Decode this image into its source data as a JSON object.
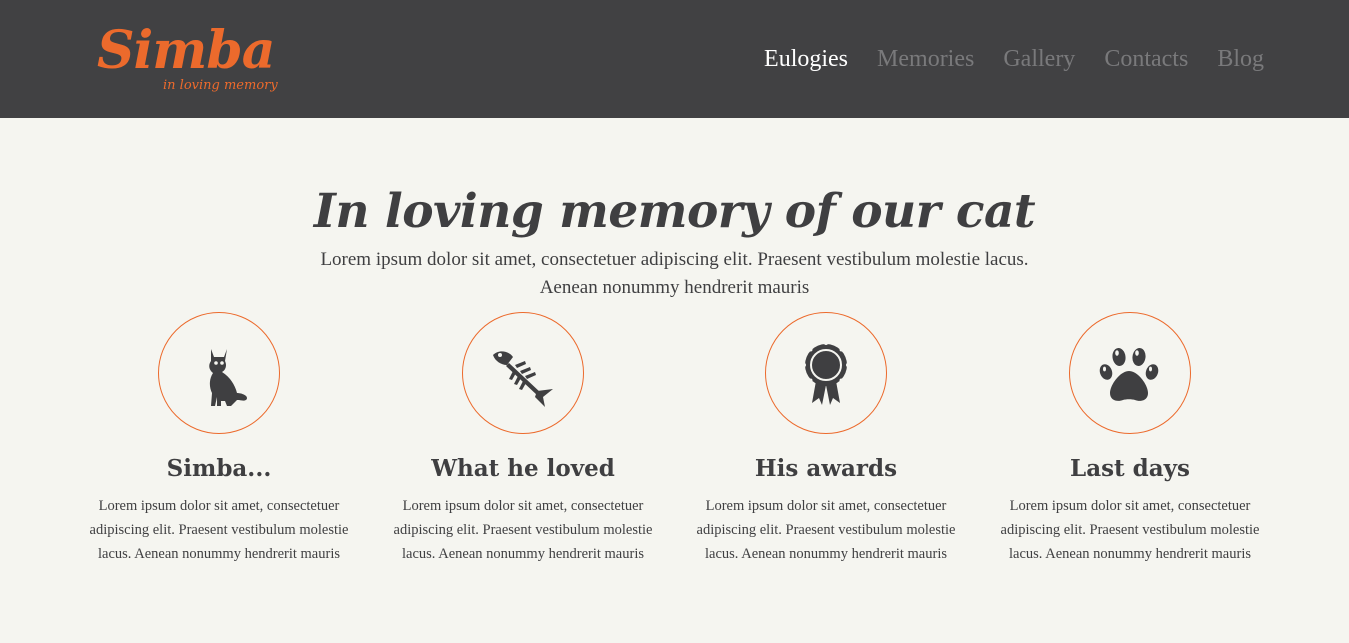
{
  "logo": {
    "name": "Simba",
    "tagline": "in loving memory"
  },
  "nav": {
    "items": [
      {
        "label": "Eulogies",
        "active": true
      },
      {
        "label": "Memories",
        "active": false
      },
      {
        "label": "Gallery",
        "active": false
      },
      {
        "label": "Contacts",
        "active": false
      },
      {
        "label": "Blog",
        "active": false
      }
    ]
  },
  "hero": {
    "title": "In loving memory of our cat",
    "subtitle_line1": "Lorem ipsum dolor sit amet, consectetuer adipiscing elit. Praesent vestibulum molestie lacus.",
    "subtitle_line2": "Aenean nonummy hendrerit mauris"
  },
  "features": [
    {
      "icon": "cat-icon",
      "title": "Simba...",
      "text": "Lorem ipsum dolor sit amet, consectetuer adipiscing elit. Praesent vestibulum molestie lacus. Aenean nonummy hendrerit mauris"
    },
    {
      "icon": "fish-bone-icon",
      "title": "What he loved",
      "text": "Lorem ipsum dolor sit amet, consectetuer adipiscing elit. Praesent vestibulum molestie lacus. Aenean nonummy hendrerit mauris"
    },
    {
      "icon": "award-rosette-icon",
      "title": "His awards",
      "text": "Lorem ipsum dolor sit amet, consectetuer adipiscing elit. Praesent vestibulum molestie lacus. Aenean nonummy hendrerit mauris"
    },
    {
      "icon": "paw-print-icon",
      "title": "Last days",
      "text": "Lorem ipsum dolor sit amet, consectetuer adipiscing elit. Praesent vestibulum molestie lacus. Aenean nonummy hendrerit mauris"
    }
  ],
  "colors": {
    "accent": "#ec6a2c",
    "header_bg": "#414143",
    "page_bg": "#f5f5f0",
    "text": "#3f3f41",
    "nav_inactive": "#79797b"
  }
}
